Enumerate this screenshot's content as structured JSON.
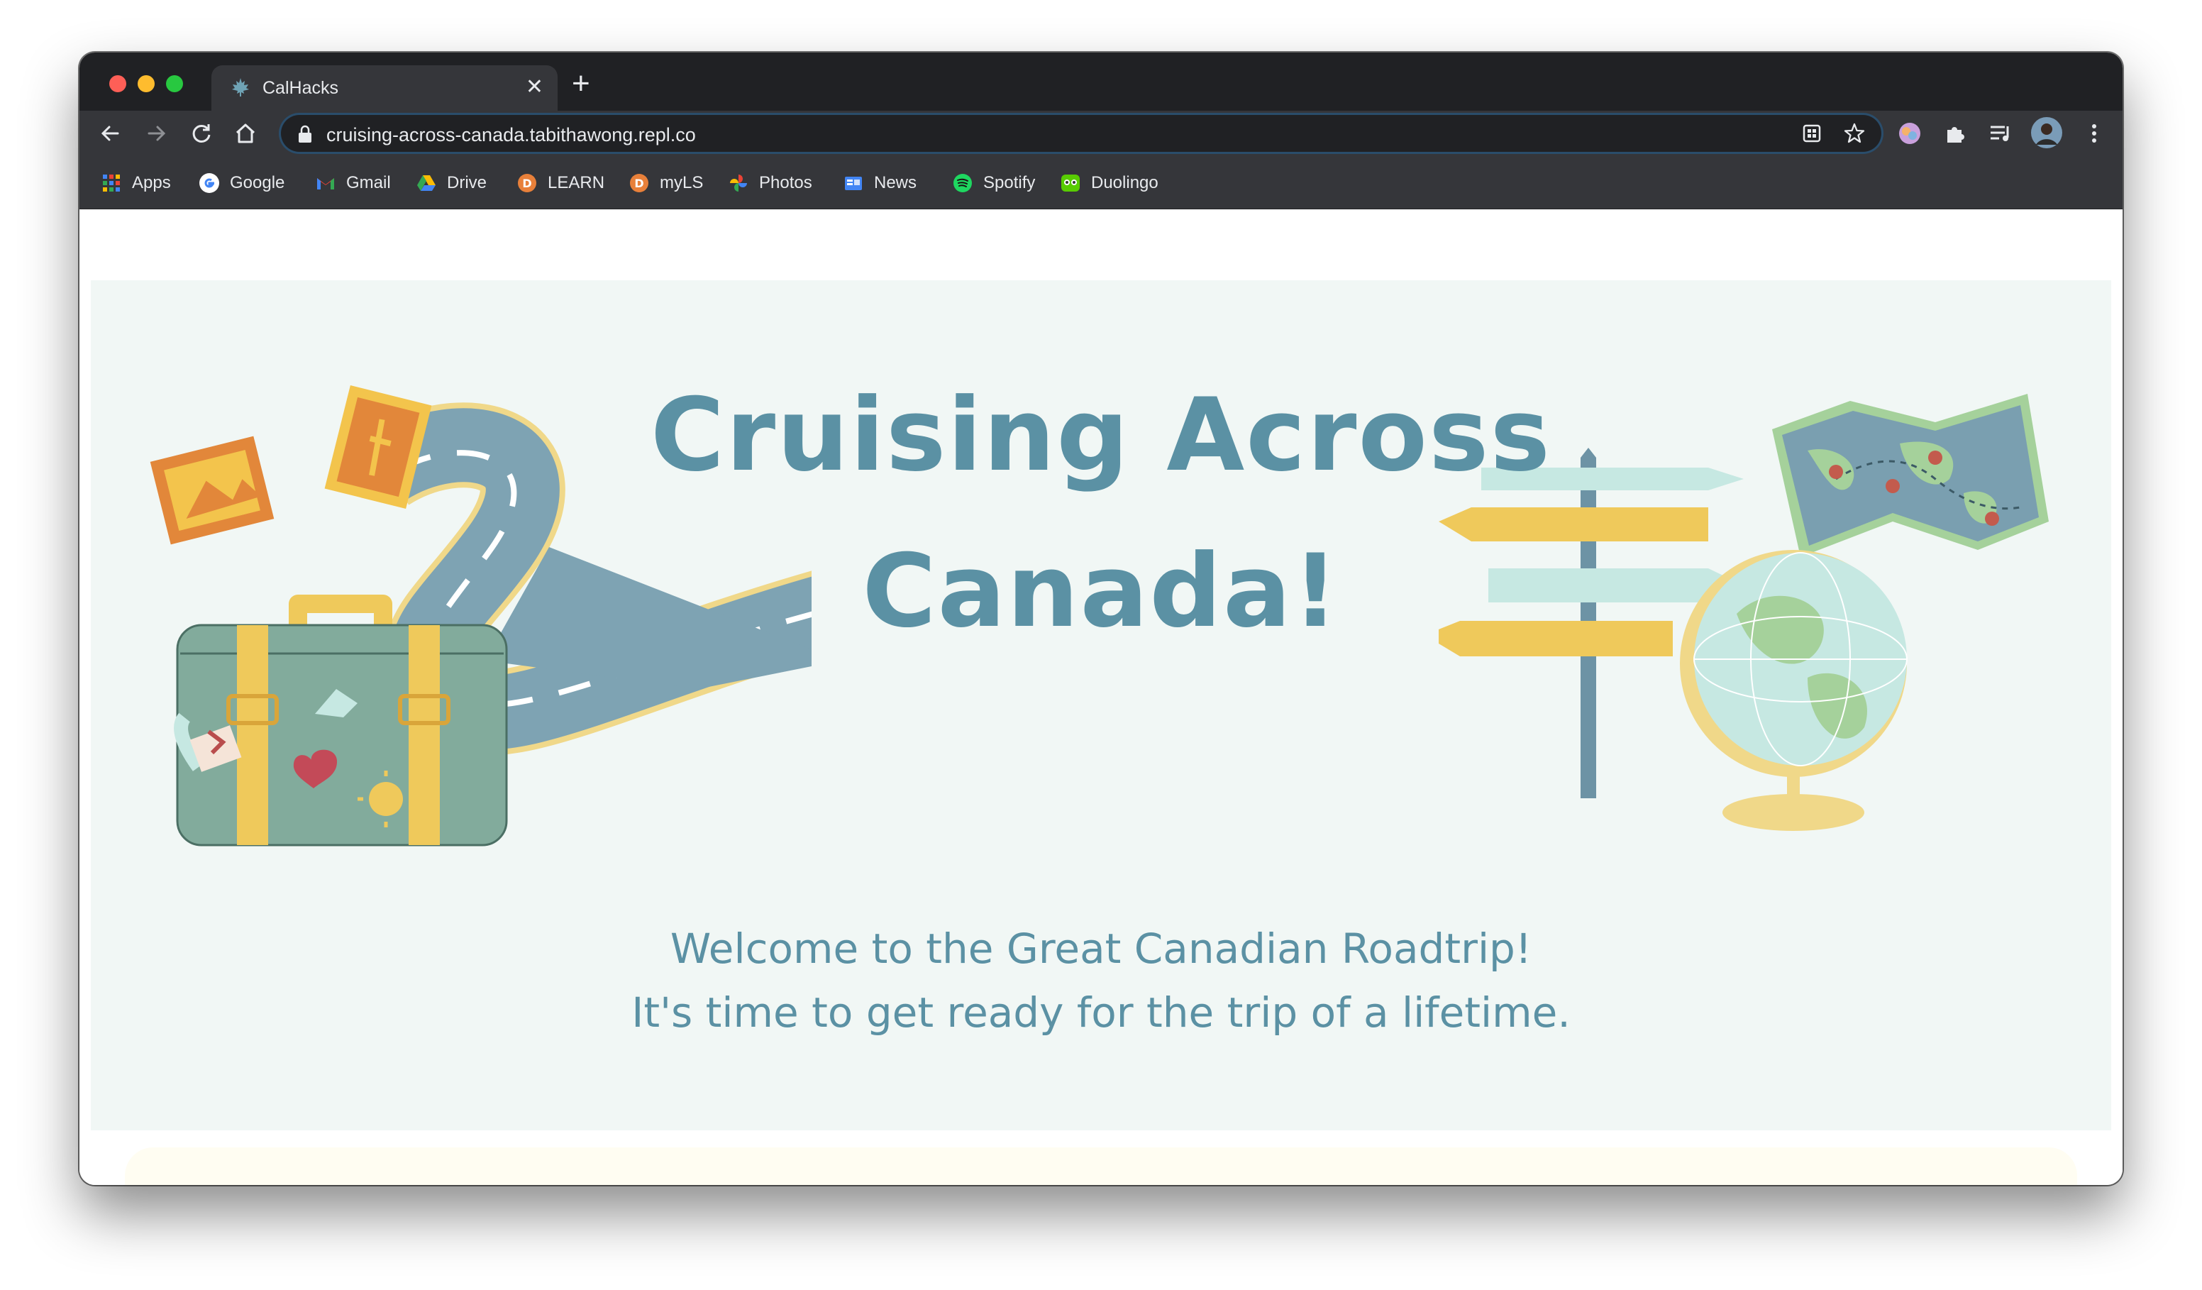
{
  "browser": {
    "tab": {
      "title": "CalHacks"
    },
    "url": "cruising-across-canada.tabithawong.repl.co",
    "bookmarks": [
      {
        "label": "Apps",
        "icon": "apps-grid-icon"
      },
      {
        "label": "Google",
        "icon": "google-icon"
      },
      {
        "label": "Gmail",
        "icon": "gmail-icon"
      },
      {
        "label": "Drive",
        "icon": "drive-icon"
      },
      {
        "label": "LEARN",
        "icon": "learn-icon"
      },
      {
        "label": "myLS",
        "icon": "myls-icon"
      },
      {
        "label": "Photos",
        "icon": "photos-icon"
      },
      {
        "label": "News",
        "icon": "news-icon"
      },
      {
        "label": "Spotify",
        "icon": "spotify-icon"
      },
      {
        "label": "Duolingo",
        "icon": "duolingo-icon"
      }
    ]
  },
  "hero": {
    "title_line1": "Cruising Across",
    "title_line2": "Canada!",
    "subtitle_line1": "Welcome to the Great Canadian Roadtrip!",
    "subtitle_line2": "It's time to get ready for the trip of a lifetime."
  },
  "colors": {
    "accent": "#5b91a4",
    "hero_bg": "#f1f7f5",
    "mustard": "#efc95b",
    "mint": "#c6e8e2"
  }
}
